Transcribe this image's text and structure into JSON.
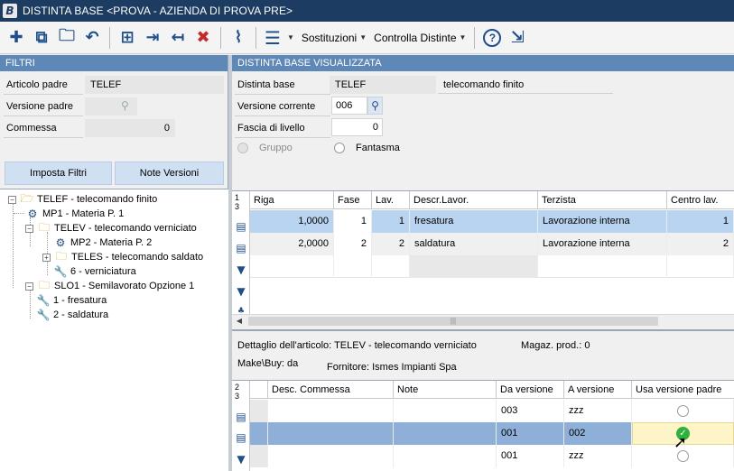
{
  "window": {
    "title": "DISTINTA BASE <PROVA - AZIENDA DI PROVA PRE>",
    "app_icon": "B"
  },
  "toolbar": {
    "sostituzioni": "Sostituzioni",
    "controlla_distinte": "Controlla Distinte"
  },
  "filtri": {
    "header": "FILTRI",
    "articolo_padre_label": "Articolo padre",
    "articolo_padre_value": "TELEF",
    "versione_padre_label": "Versione padre",
    "commessa_label": "Commessa",
    "commessa_value": "0",
    "imposta_filtri": "Imposta Filtri",
    "note_versioni": "Note Versioni"
  },
  "tree": {
    "items": [
      {
        "label": "TELEF - telecomando finito"
      },
      {
        "label": "MP1 - Materia P. 1"
      },
      {
        "label": "TELEV - telecomando verniciato"
      },
      {
        "label": "MP2 - Materia P. 2"
      },
      {
        "label": "TELES - telecomando saldato"
      },
      {
        "label": "6 - verniciatura"
      },
      {
        "label": "SLO1 - Semilavorato Opzione 1"
      },
      {
        "label": "1 - fresatura"
      },
      {
        "label": "2 - saldatura"
      }
    ]
  },
  "distinta": {
    "header": "DISTINTA BASE VISUALIZZATA",
    "distinta_base_label": "Distinta base",
    "distinta_base_code": "TELEF",
    "distinta_base_desc": "telecomando finito",
    "versione_corrente_label": "Versione corrente",
    "versione_corrente_value": "006",
    "fascia_label": "Fascia di livello",
    "fascia_value": "0",
    "gruppo_label": "Gruppo",
    "fantasma_label": "Fantasma"
  },
  "grid1": {
    "row_count_top": "1",
    "row_count_bottom": "3",
    "columns": [
      "Riga",
      "Fase",
      "Lav.",
      "Descr.Lavor.",
      "Terzista",
      "Centro lav."
    ],
    "rows": [
      {
        "riga": "1,0000",
        "fase": "1",
        "lav": "1",
        "descr": "fresatura",
        "terzista": "Lavorazione interna",
        "centro": "1"
      },
      {
        "riga": "2,0000",
        "fase": "2",
        "lav": "2",
        "descr": "saldatura",
        "terzista": "Lavorazione interna",
        "centro": "2"
      }
    ]
  },
  "dettaglio": {
    "articolo_text": "Dettaglio dell'articolo: TELEV - telecomando verniciato",
    "magaz_text": "Magaz. prod.: 0",
    "makebuy_text": "Make\\Buy: da",
    "fornitore_text": "Fornitore: Ismes Impianti Spa"
  },
  "grid2": {
    "row_count_top": "2",
    "row_count_bottom": "3",
    "columns": [
      "Desc. Commessa",
      "Note",
      "Da versione",
      "A versione",
      "Usa versione padre"
    ],
    "rows": [
      {
        "desc": "",
        "note": "",
        "da": "003",
        "a": "zzz",
        "usa": false
      },
      {
        "desc": "",
        "note": "",
        "da": "001",
        "a": "002",
        "usa": true
      },
      {
        "desc": "",
        "note": "",
        "da": "001",
        "a": "zzz",
        "usa": false
      }
    ]
  },
  "colors": {
    "titlebar": "#1c3c62",
    "panel_header": "#5e88b8",
    "selected_row": "#b8d4f0",
    "selected_row_dark": "#8eb0d8",
    "toolbar_icon": "#1f4e8c"
  }
}
